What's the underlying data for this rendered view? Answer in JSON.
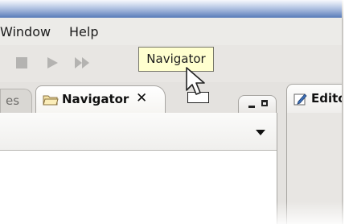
{
  "menubar": {
    "items": [
      "Window",
      "Help"
    ]
  },
  "toolbar": {
    "icons": [
      "stop-icon",
      "play-icon",
      "fast-forward-icon"
    ]
  },
  "tooltip": {
    "text": "Navigator"
  },
  "tabs": {
    "previous_tab_label": "es",
    "navigator": {
      "label": "Navigator",
      "close_glyph": "✕"
    },
    "editor": {
      "label": "Editor"
    }
  },
  "colors": {
    "tooltip_bg": "#ffffcf",
    "titlebar": "#2d5aa9",
    "panel_bg": "#e4e2df"
  }
}
